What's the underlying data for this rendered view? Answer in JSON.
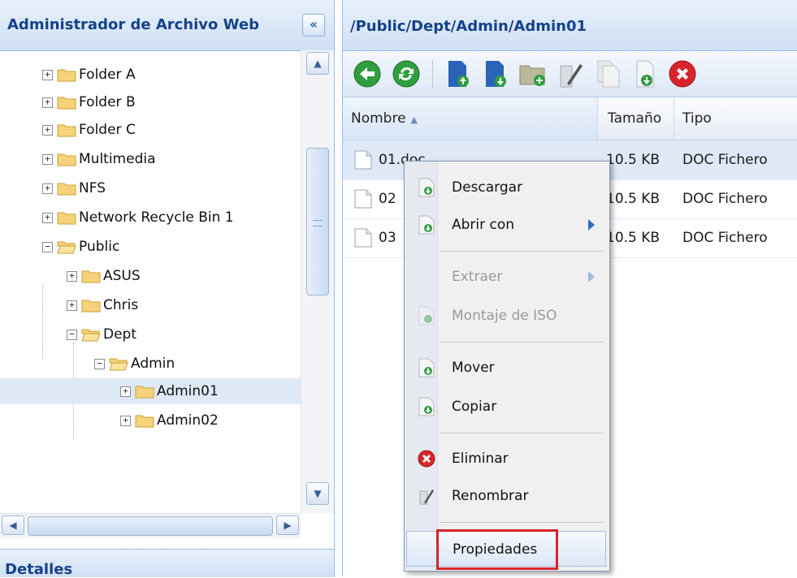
{
  "left_panel": {
    "title": "Administrador de Archivo Web",
    "collapse_label": "«",
    "tree": [
      {
        "label": "Folder A",
        "expander": "+"
      },
      {
        "label": "Folder B",
        "expander": "+"
      },
      {
        "label": "Folder C",
        "expander": "+"
      },
      {
        "label": "Multimedia",
        "expander": "+"
      },
      {
        "label": "NFS",
        "expander": "+"
      },
      {
        "label": "Network Recycle Bin 1",
        "expander": "+"
      },
      {
        "label": "Public",
        "expander": "−"
      },
      {
        "label": "ASUS",
        "expander": "+"
      },
      {
        "label": "Chris",
        "expander": "+"
      },
      {
        "label": "Dept",
        "expander": "−"
      },
      {
        "label": "Admin",
        "expander": "−"
      },
      {
        "label": "Admin01",
        "expander": "+",
        "selected": true
      },
      {
        "label": "Admin02",
        "expander": "+"
      }
    ],
    "details_title": "Detalles"
  },
  "right_panel": {
    "path": "/Public/Dept/Admin/Admin01",
    "toolbar": [
      "back-icon",
      "refresh-icon",
      "upload-file-icon",
      "upload-folder-icon",
      "new-folder-icon",
      "rename-icon",
      "copy-icon",
      "download-icon",
      "delete-icon"
    ],
    "columns": {
      "name": "Nombre",
      "size": "Tamaño",
      "type": "Tipo"
    },
    "rows": [
      {
        "name": "01.doc",
        "size": "10.5 KB",
        "type": "DOC Fichero"
      },
      {
        "name": "02",
        "size": "10.5 KB",
        "type": "DOC Fichero"
      },
      {
        "name": "03",
        "size": "10.5 KB",
        "type": "DOC Fichero"
      }
    ]
  },
  "context_menu": {
    "download": "Descargar",
    "open_with": "Abrir con",
    "extract": "Extraer",
    "mount_iso": "Montaje de ISO",
    "move": "Mover",
    "copy": "Copiar",
    "delete": "Eliminar",
    "rename": "Renombrar",
    "properties": "Propiedades"
  },
  "colors": {
    "header_text": "#15428b",
    "selection": "#dfe8f6",
    "highlight_box": "#d7242b"
  }
}
